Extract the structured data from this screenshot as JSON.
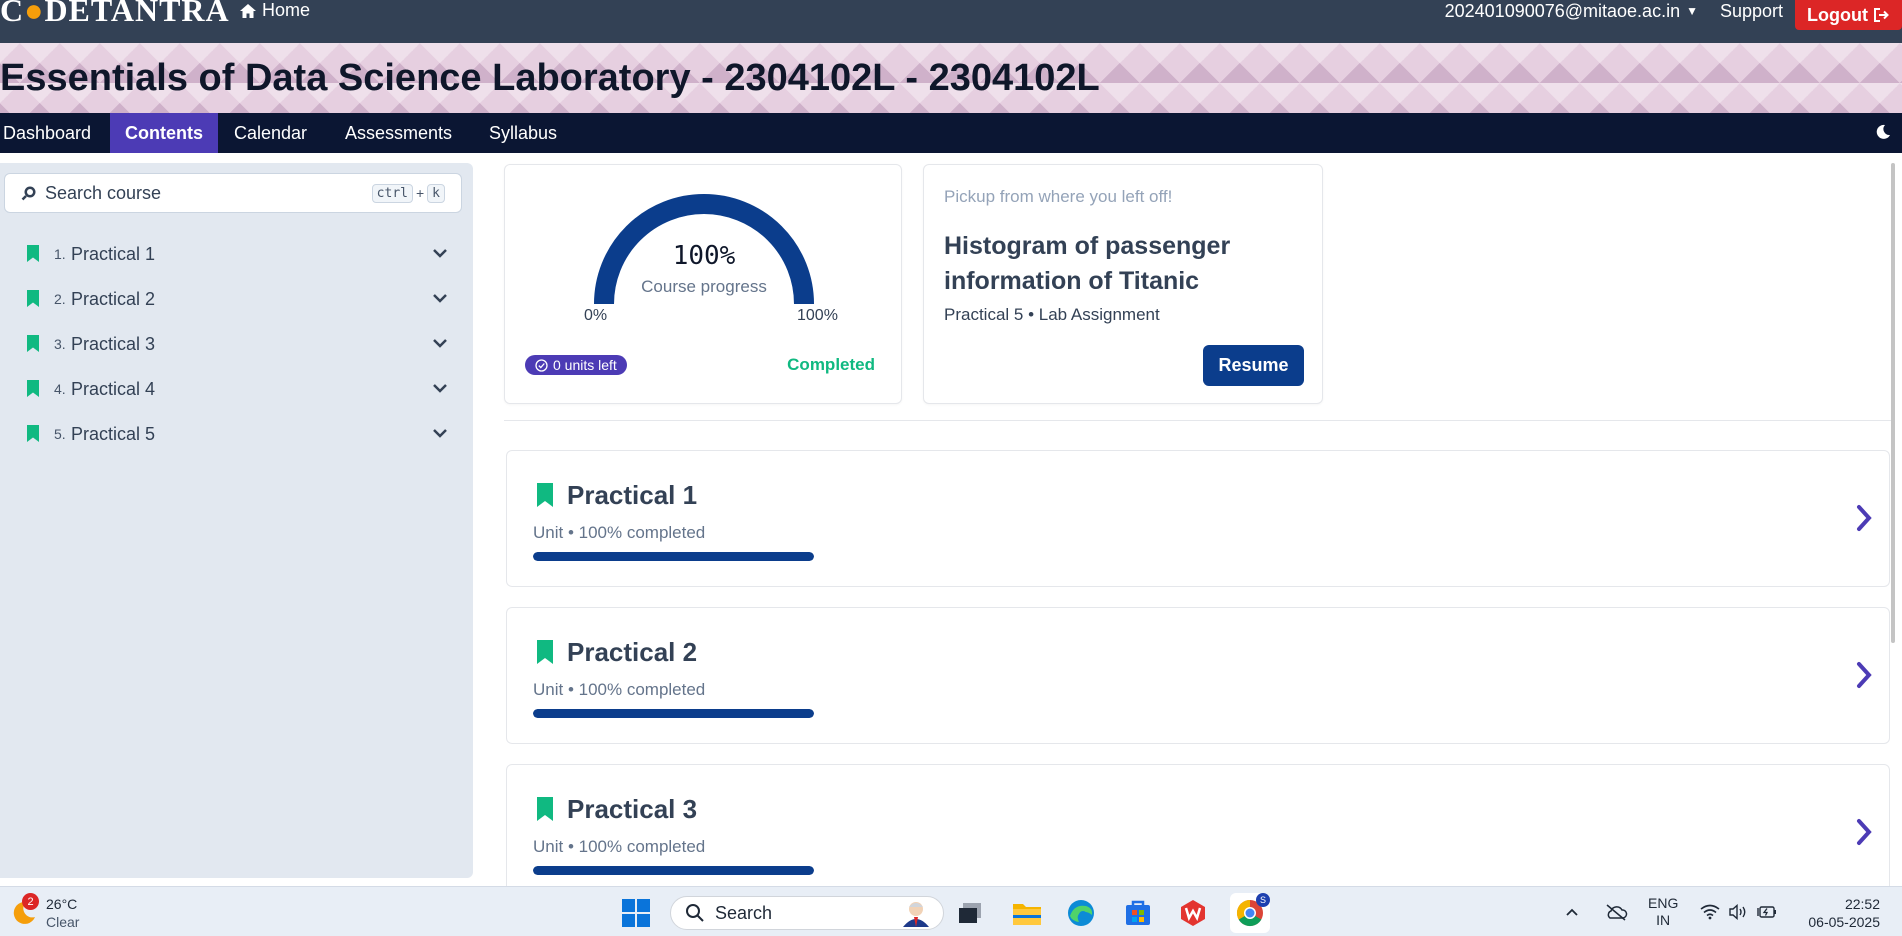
{
  "topbar": {
    "logo_text": "C DETANTRA",
    "home_label": "Home",
    "user_email": "202401090076@mitaoe.ac.in",
    "support_label": "Support",
    "logout_label": "Logout"
  },
  "banner": {
    "course_title": "Essentials of Data Science Laboratory - 2304102L - 2304102L"
  },
  "nav": {
    "tabs": [
      {
        "label": "Dashboard"
      },
      {
        "label": "Contents",
        "active": true
      },
      {
        "label": "Calendar"
      },
      {
        "label": "Assessments"
      },
      {
        "label": "Syllabus"
      }
    ]
  },
  "sidebar": {
    "search_placeholder": "Search course",
    "shortcut_key1": "ctrl",
    "shortcut_plus": "+",
    "shortcut_key2": "k",
    "units": [
      {
        "num": "1.",
        "label": "Practical 1"
      },
      {
        "num": "2.",
        "label": "Practical 2"
      },
      {
        "num": "3.",
        "label": "Practical 3"
      },
      {
        "num": "4.",
        "label": "Practical 4"
      },
      {
        "num": "5.",
        "label": "Practical 5"
      }
    ]
  },
  "progress": {
    "percent_text": "100%",
    "percent_value": 1.0,
    "label": "Course progress",
    "min_label": "0%",
    "max_label": "100%",
    "units_left": "0 units left",
    "status": "Completed"
  },
  "resume": {
    "pickup_text": "Pickup from where you left off!",
    "title": "Histogram of passenger information of Titanic",
    "subtitle": "Practical 5 • Lab Assignment",
    "button_label": "Resume"
  },
  "practicals": [
    {
      "title": "Practical 1",
      "subtitle": "Unit • 100% completed",
      "progress": 1.0
    },
    {
      "title": "Practical 2",
      "subtitle": "Unit • 100% completed",
      "progress": 1.0
    },
    {
      "title": "Practical 3",
      "subtitle": "Unit • 100% completed",
      "progress": 1.0
    }
  ],
  "taskbar": {
    "weather_badge": "2",
    "temperature": "26°C",
    "condition": "Clear",
    "search_label": "Search",
    "lang_line1": "ENG",
    "lang_line2": "IN",
    "time": "22:52",
    "date": "06-05-2025",
    "chrome_badge": "S"
  },
  "colors": {
    "accent_purple": "#4c3bb5",
    "primary_navy": "#0b3d8c",
    "success_green": "#10b981",
    "logout_red": "#dc2626",
    "bookmark_green": "#10b981"
  }
}
